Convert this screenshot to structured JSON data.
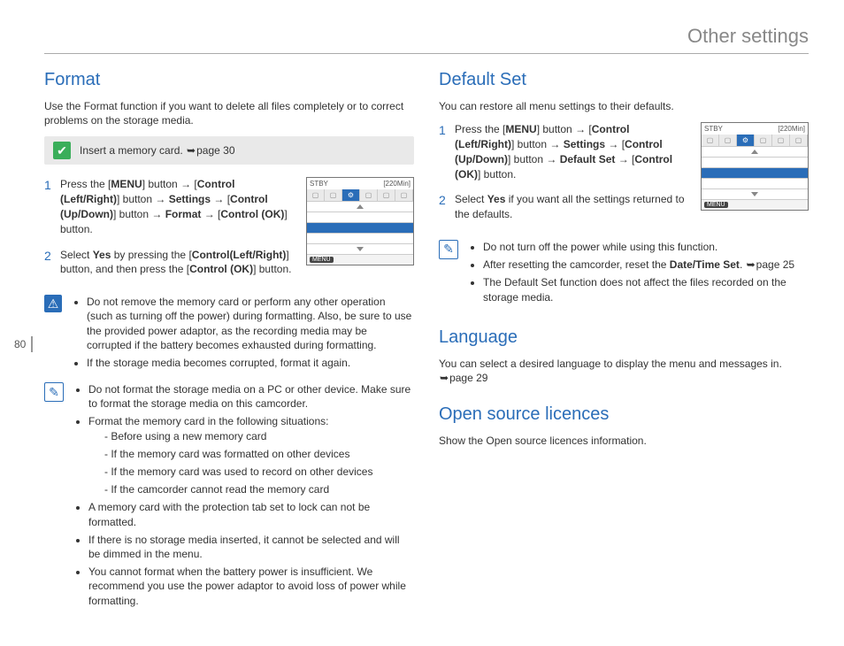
{
  "header": {
    "title": "Other settings"
  },
  "page_number": "80",
  "left": {
    "format": {
      "heading": "Format",
      "intro": "Use the Format function if you want to delete all files completely or to correct problems on the storage media.",
      "memcard_note_pre": "Insert a memory card. ",
      "memcard_note_ref": "page 30",
      "step1": {
        "t1": "Press the [",
        "menu": "MENU",
        "t2": "] button → [",
        "ctrl_lr": "Control (Left/Right)",
        "t3": "] button → ",
        "settings": "Settings",
        "t4": " → [",
        "ctrl_ud": "Control (Up/Down)",
        "t5": "] button → ",
        "format": "Format",
        "t6": " → [",
        "ctrl_ok": "Control (OK)",
        "t7": "] button."
      },
      "step2": {
        "t1": "Select ",
        "yes": "Yes",
        "t2": " by pressing the [",
        "ctrl_lr": "Control(Left/Right)",
        "t3": "] button, and then press the [",
        "ctrl_ok": "Control (OK)",
        "t4": "] button."
      },
      "warn": {
        "w1": "Do not remove the memory card or perform any other operation (such as turning off the power) during formatting. Also, be sure to use the provided power adaptor, as the recording media may be corrupted if the battery becomes exhausted during formatting.",
        "w2": "If the storage media becomes corrupted, format it again."
      },
      "info": {
        "i1": "Do not format the storage media on a PC or other device. Make sure to format the storage media on this camcorder.",
        "i2": "Format the memory card in the following situations:",
        "i2a": "Before using a new memory card",
        "i2b": "If the memory card was formatted on other devices",
        "i2c": "If the memory card was used to record on other devices",
        "i2d": "If the camcorder cannot read the memory card",
        "i3": "A memory card with the protection tab set to lock can not be formatted.",
        "i4": "If there is no storage media inserted, it cannot be selected and will be dimmed in the menu.",
        "i5": "You cannot format when the battery power is insufficient. We recommend you use the power adaptor to avoid loss of power while formatting."
      }
    }
  },
  "right": {
    "default_set": {
      "heading": "Default Set",
      "intro": "You can restore all menu settings to their defaults.",
      "step1": {
        "t1": "Press the [",
        "menu": "MENU",
        "t2": "] button → [",
        "ctrl_lr": "Control (Left/Right)",
        "t3": "] button → ",
        "settings": "Settings",
        "t4": " → [",
        "ctrl_ud": "Control (Up/Down)",
        "t5": "] button → ",
        "default_set": "Default Set",
        "t6": " → [",
        "ctrl_ok": "Control (OK)",
        "t7": "] button."
      },
      "step2": {
        "t1": "Select ",
        "yes": "Yes",
        "t2": " if you want all the settings returned to the defaults."
      },
      "notes": {
        "n1": "Do not turn off the power while using this function.",
        "n2_a": "After resetting the camcorder, reset the ",
        "n2_b": "Date/Time Set",
        "n2_c": ". ",
        "n2_ref": "page 25",
        "n3": "The Default Set function does not affect the files recorded on the storage media."
      }
    },
    "language": {
      "heading": "Language",
      "text_a": "You can select a desired language to display the menu and messages in. ",
      "text_ref": "page 29"
    },
    "osl": {
      "heading": "Open source licences",
      "text": "Show the Open source licences information."
    }
  },
  "lcd": {
    "standby": "STBY",
    "time": "[220Min]",
    "menu": "MENU",
    "tab_active": "⚙"
  }
}
